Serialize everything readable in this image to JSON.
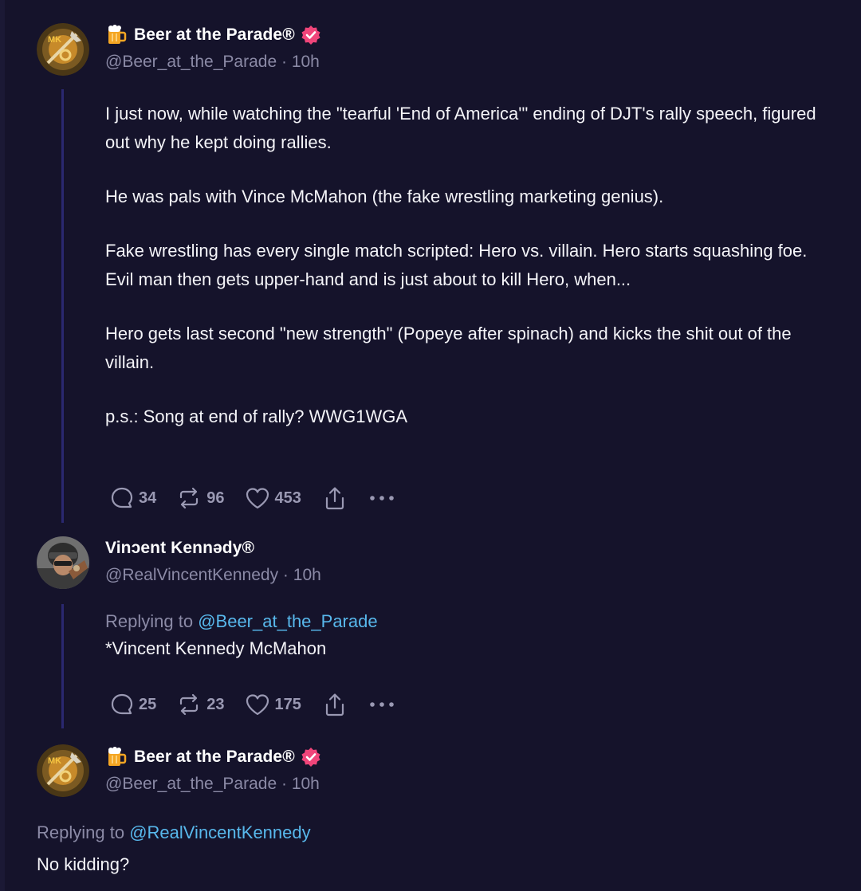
{
  "posts": [
    {
      "display_name": "Beer at the Parade®",
      "handle": "@Beer_at_the_Parade",
      "separator": "·",
      "time": "10h",
      "badge_icon": "beer-mug-icon",
      "verified": true,
      "paragraphs": [
        "I just now, while watching the \"tearful 'End of America'\" ending of DJT's rally speech, figured out why he kept doing rallies.",
        "He was pals with Vince McMahon (the fake wrestling marketing genius).",
        "Fake wrestling has every single match scripted: Hero vs. villain. Hero starts squashing foe. Evil man then gets upper-hand and is just about to kill Hero, when...",
        "Hero gets last second \"new strength\" (Popeye after spinach) and kicks the shit out of the villain.",
        "p.s.: Song at end of rally? WWG1WGA"
      ],
      "replies": "34",
      "reposts": "96",
      "likes": "453"
    },
    {
      "display_name": "Vinɔent Kennədy®",
      "handle": "@RealVincentKennedy",
      "separator": "·",
      "time": "10h",
      "replying_label": "Replying to",
      "replying_to": "@Beer_at_the_Parade",
      "text": "*Vincent Kennedy McMahon",
      "replies": "25",
      "reposts": "23",
      "likes": "175"
    },
    {
      "display_name": "Beer at the Parade®",
      "handle": "@Beer_at_the_Parade",
      "separator": "·",
      "time": "10h",
      "badge_icon": "beer-mug-icon",
      "verified": true,
      "replying_label": "Replying to",
      "replying_to": "@RealVincentKennedy",
      "text": "No kidding?"
    }
  ],
  "colors": {
    "background": "#15132b",
    "thread_line": "#2a2870",
    "muted_text": "#8b8aa6",
    "mention": "#58b8ec",
    "verified": "#f0457a"
  }
}
